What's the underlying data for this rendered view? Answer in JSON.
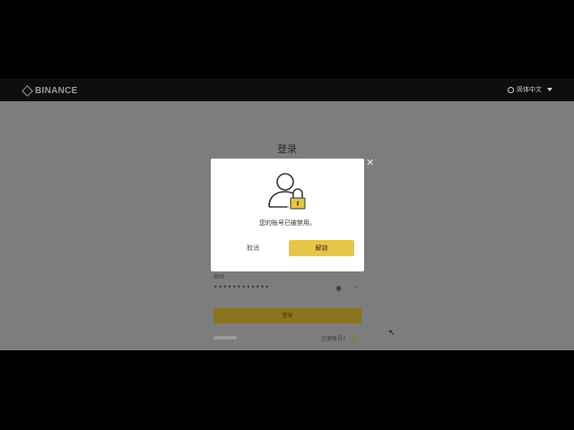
{
  "header": {
    "logo_text": "BINANCE",
    "language": "简体中文"
  },
  "login": {
    "title": "登录",
    "password_label": "密码",
    "password_value": "••••••••••••",
    "eye_toggle": "👁",
    "submit_label": "登录",
    "footer_right_text": "注册账号?"
  },
  "modal": {
    "icon": "account-locked-icon",
    "message": "您的账号已被禁用。",
    "cancel_label": "取消",
    "unlock_label": "解锁"
  },
  "colors": {
    "overlay_gray": "#7d7d7d",
    "accent_yellow": "#e7c548",
    "muted_yellow": "#8c7420"
  }
}
